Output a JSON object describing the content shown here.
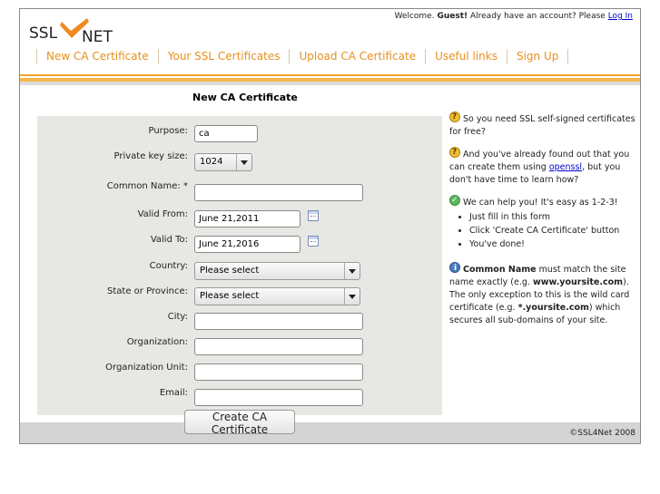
{
  "header": {
    "logo_text_left": "SSL",
    "logo_text_right": "NET",
    "welcome_prefix": "Welcome.",
    "welcome_user": "Guest!",
    "welcome_suffix": "Already have an account? Please",
    "login_link": "Log In"
  },
  "nav": {
    "items": [
      {
        "label": "New CA Certificate"
      },
      {
        "label": "Your SSL Certificates"
      },
      {
        "label": "Upload CA Certificate"
      },
      {
        "label": "Useful links"
      },
      {
        "label": "Sign Up"
      }
    ]
  },
  "form": {
    "title": "New CA Certificate",
    "purpose": {
      "label": "Purpose:",
      "value": "ca"
    },
    "key_size": {
      "label": "Private key size:",
      "value": "1024"
    },
    "common_name": {
      "label": "Common Name: *",
      "value": ""
    },
    "valid_from": {
      "label": "Valid From:",
      "value": "June 21,2011"
    },
    "valid_to": {
      "label": "Valid To:",
      "value": "June 21,2016"
    },
    "country": {
      "label": "Country:",
      "value": "Please select"
    },
    "state": {
      "label": "State or Province:",
      "value": "Please select"
    },
    "city": {
      "label": "City:",
      "value": ""
    },
    "organization": {
      "label": "Organization:",
      "value": ""
    },
    "org_unit": {
      "label": "Organization Unit:",
      "value": ""
    },
    "email": {
      "label": "Email:",
      "value": ""
    },
    "submit_label": "Create CA Certificate"
  },
  "sidebar": {
    "p1": "So you need SSL self-signed certificates for free?",
    "p2_before": "And you've already found out that you can create them using",
    "p2_link": "openssl",
    "p2_after": ", but you don't have time to learn how?",
    "p3": "We can help you! It's easy as 1-2-3!",
    "steps": [
      "Just fill in this form",
      "Click 'Create CA Certificate' button",
      "You've done!"
    ],
    "p4_bold": "Common Name",
    "p4_a": "must match the site name exactly (e.g.",
    "p4_ex1": "www.yoursite.com",
    "p4_b": "). The only exception to this is the wild card certificate (e.g.",
    "p4_ex2": "*.yoursite.com",
    "p4_c": ") which secures all sub-domains of your site."
  },
  "footer": {
    "copyright": "©SSL4Net 2008"
  },
  "colors": {
    "accent": "#e8901c",
    "nav_bar": "#f2a22a",
    "form_bg": "#e7e7e4",
    "footer_bg": "#d4d4d4"
  }
}
